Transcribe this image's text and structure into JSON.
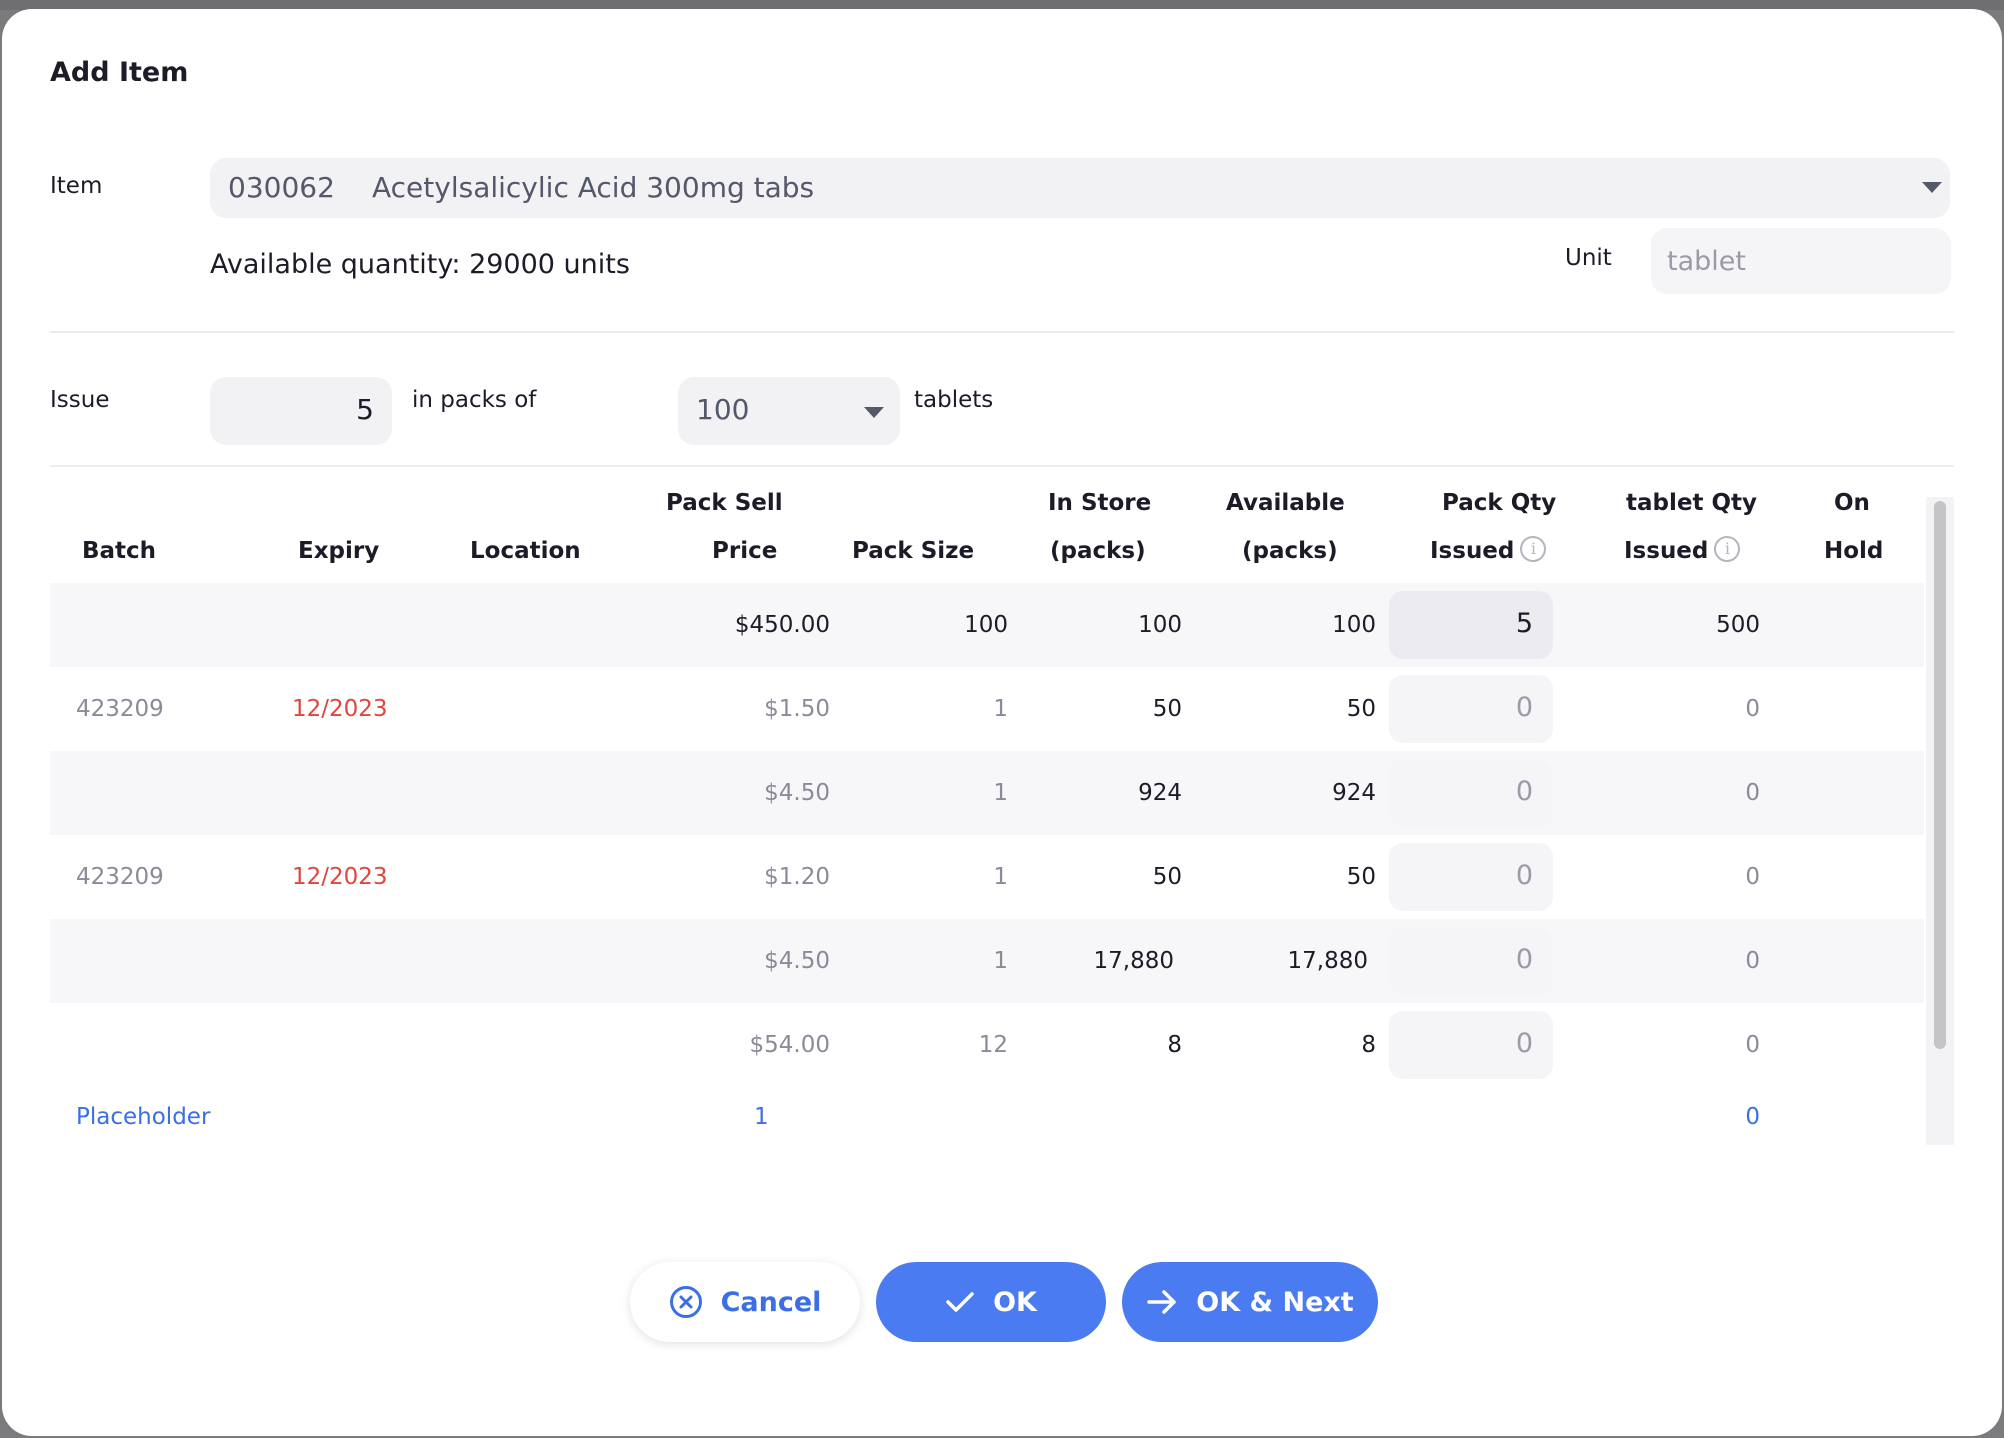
{
  "dialog": {
    "title": "Add Item",
    "item_label": "Item",
    "item_code": "030062",
    "item_name": "Acetylsalicylic Acid 300mg tabs",
    "available_quantity": "Available quantity: 29000 units",
    "unit_label": "Unit",
    "unit_value": "tablet",
    "issue_label": "Issue",
    "issue_value": "5",
    "in_packs_of": "in packs of",
    "pack_size_value": "100",
    "tablets_label": "tablets"
  },
  "table": {
    "headers": {
      "batch": "Batch",
      "expiry": "Expiry",
      "location": "Location",
      "pack_sell_1": "Pack Sell",
      "pack_sell_2": "Price",
      "pack_size": "Pack Size",
      "in_store_1": "In Store",
      "in_store_2": "(packs)",
      "available_1": "Available",
      "available_2": "(packs)",
      "pack_qty_1": "Pack Qty",
      "pack_qty_2": "Issued",
      "tablet_qty_1": "tablet Qty",
      "tablet_qty_2": "Issued",
      "on_hold_1": "On",
      "on_hold_2": "Hold"
    },
    "rows": [
      {
        "batch": "",
        "expiry": "",
        "price": "$450.00",
        "pack_size": "100",
        "in_store": "100",
        "available": "100",
        "pack_qty": "5",
        "tablet_qty": "500"
      },
      {
        "batch": "423209",
        "expiry": "12/2023",
        "price": "$1.50",
        "pack_size": "1",
        "in_store": "50",
        "available": "50",
        "pack_qty": "0",
        "tablet_qty": "0"
      },
      {
        "batch": "",
        "expiry": "",
        "price": "$4.50",
        "pack_size": "1",
        "in_store": "924",
        "available": "924",
        "pack_qty": "0",
        "tablet_qty": "0"
      },
      {
        "batch": "423209",
        "expiry": "12/2023",
        "price": "$1.20",
        "pack_size": "1",
        "in_store": "50",
        "available": "50",
        "pack_qty": "0",
        "tablet_qty": "0"
      },
      {
        "batch": "",
        "expiry": "",
        "price": "$4.50",
        "pack_size": "1",
        "in_store": "17,880",
        "available": "17,880",
        "pack_qty": "0",
        "tablet_qty": "0"
      },
      {
        "batch": "",
        "expiry": "",
        "price": "$54.00",
        "pack_size": "12",
        "in_store": "8",
        "available": "8",
        "pack_qty": "0",
        "tablet_qty": "0"
      }
    ],
    "placeholder_row": {
      "batch": "Placeholder",
      "pack_size": "1",
      "tablet_qty": "0"
    }
  },
  "buttons": {
    "cancel": "Cancel",
    "ok": "OK",
    "ok_next": "OK & Next"
  },
  "colors": {
    "accent": "#4a7bf0",
    "expiry_warning": "#e0463e",
    "placeholder": "#3b6fe6"
  }
}
